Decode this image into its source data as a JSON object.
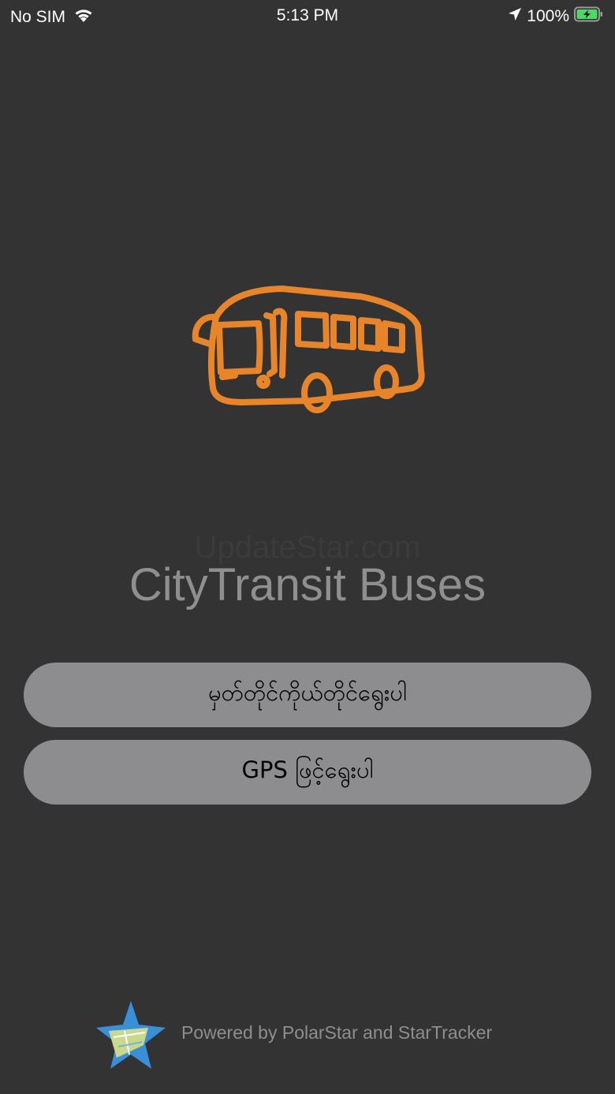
{
  "status_bar": {
    "carrier": "No SIM",
    "time": "5:13 PM",
    "battery_percent": "100%",
    "icons": [
      "wifi-icon",
      "location-arrow-icon",
      "battery-charging-icon"
    ]
  },
  "splash": {
    "logo_icon": "bus-icon",
    "logo_color": "#e8852a",
    "watermark": "UpdateStar.com",
    "title": "CityTransit Buses"
  },
  "buttons": {
    "manual_select_label": "မှတ်တိုင်ကိုယ်တိုင်ရွေးပါ",
    "gps_select_label": "GPS ဖြင့်ရွေးပါ"
  },
  "footer": {
    "logo_icon": "polarstar-logo-icon",
    "powered_by": "Powered by PolarStar and StarTracker"
  },
  "colors": {
    "background": "#333333",
    "button": "#8d8d90",
    "title": "#8f8f8f"
  }
}
